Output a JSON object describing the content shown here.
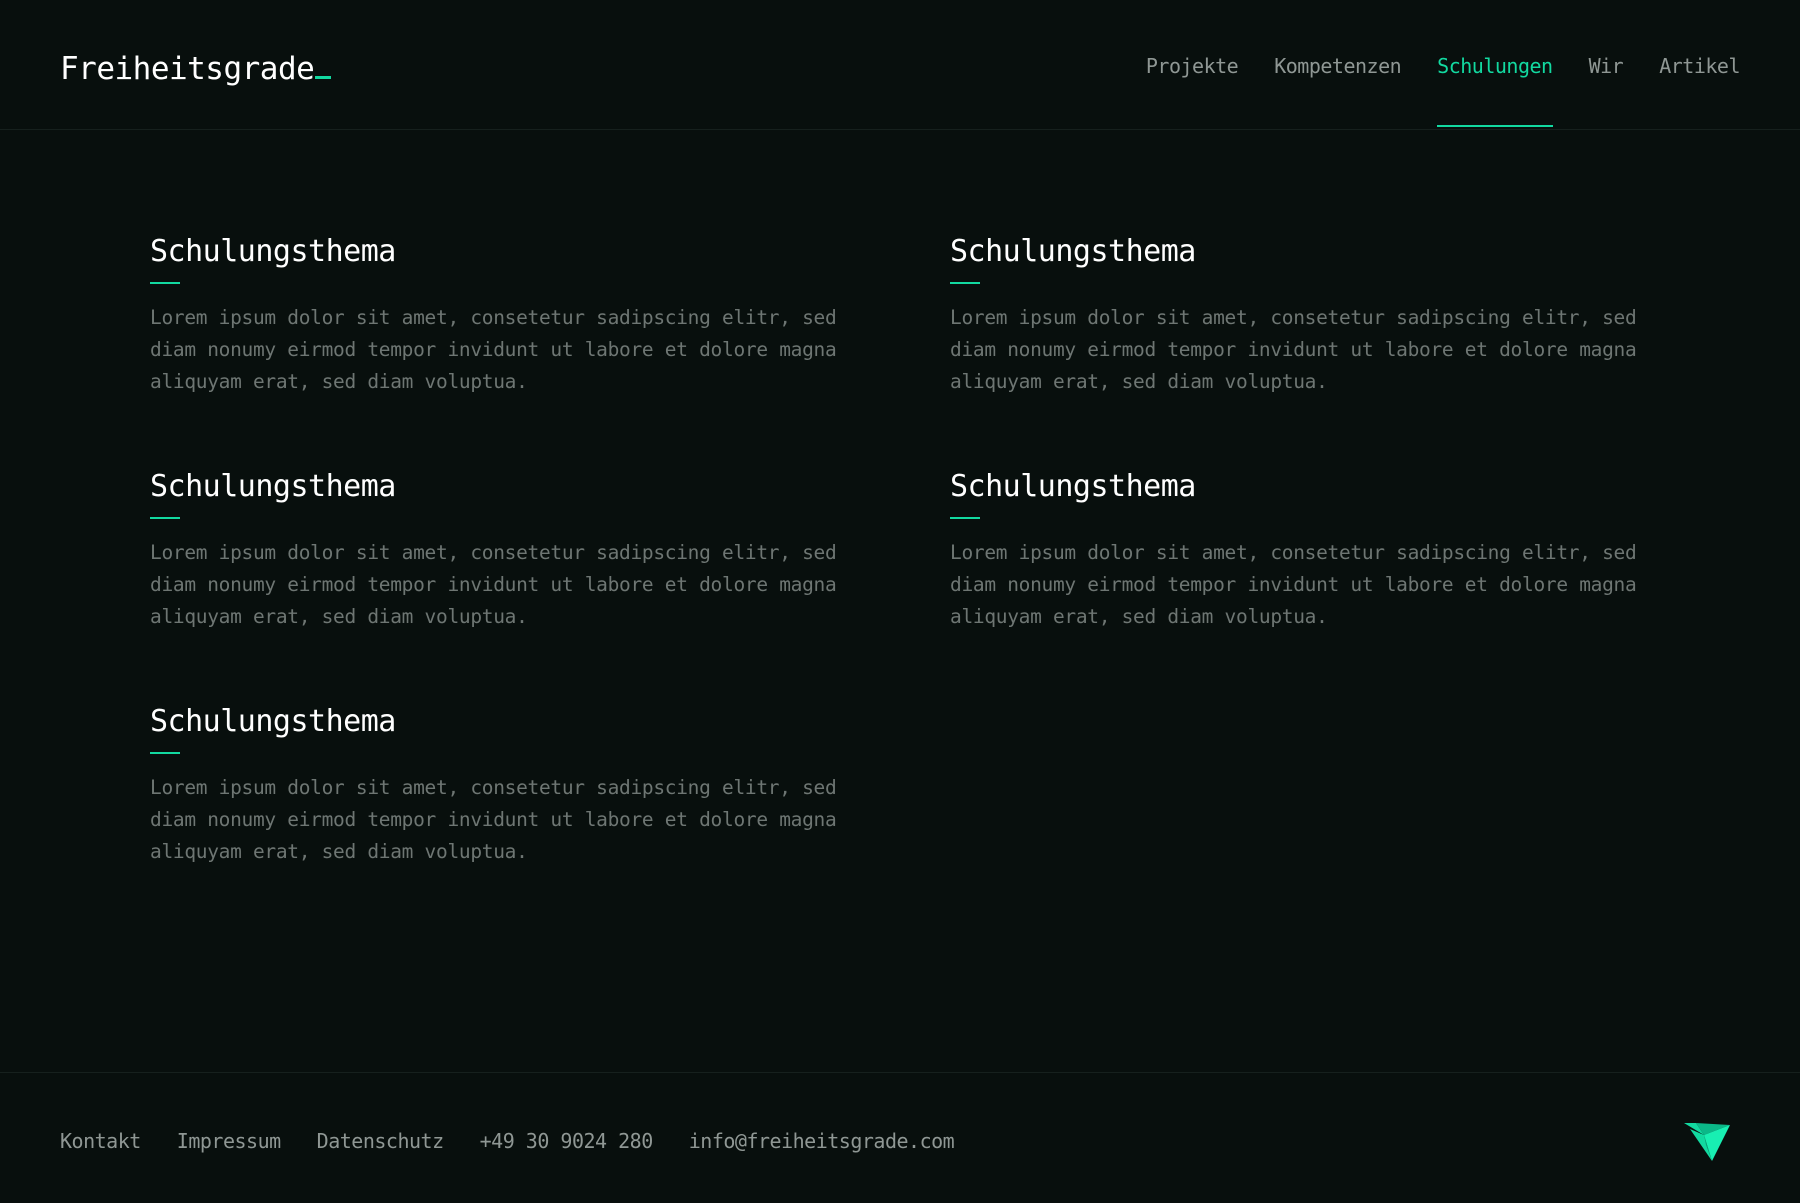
{
  "header": {
    "logo": "Freiheitsgrade",
    "nav": [
      {
        "label": "Projekte",
        "active": false
      },
      {
        "label": "Kompetenzen",
        "active": false
      },
      {
        "label": "Schulungen",
        "active": true
      },
      {
        "label": "Wir",
        "active": false
      },
      {
        "label": "Artikel",
        "active": false
      }
    ]
  },
  "topics": [
    {
      "title": "Schulungsthema",
      "text": "Lorem ipsum dolor sit amet, consetetur sadipscing elitr, sed diam nonumy eirmod tempor invidunt ut labore et dolore magna aliquyam erat, sed diam voluptua."
    },
    {
      "title": "Schulungsthema",
      "text": "Lorem ipsum dolor sit amet, consetetur sadipscing elitr, sed diam nonumy eirmod tempor invidunt ut labore et dolore magna aliquyam erat, sed diam voluptua."
    },
    {
      "title": "Schulungsthema",
      "text": "Lorem ipsum dolor sit amet, consetetur sadipscing elitr, sed diam nonumy eirmod tempor invidunt ut labore et dolore magna aliquyam erat, sed diam voluptua."
    },
    {
      "title": "Schulungsthema",
      "text": "Lorem ipsum dolor sit amet, consetetur sadipscing elitr, sed diam nonumy eirmod tempor invidunt ut labore et dolore magna aliquyam erat, sed diam voluptua."
    },
    {
      "title": "Schulungsthema",
      "text": "Lorem ipsum dolor sit amet, consetetur sadipscing elitr, sed diam nonumy eirmod tempor invidunt ut labore et dolore magna aliquyam erat, sed diam voluptua."
    }
  ],
  "footer": {
    "links": [
      "Kontakt",
      "Impressum",
      "Datenschutz",
      "+49 30 9024 280",
      "info@freiheitsgrade.com"
    ],
    "brand_icon": "origami-bird-icon"
  },
  "colors": {
    "background": "#080f0d",
    "accent": "#12d9a0",
    "text": "#ffffff",
    "muted": "#8f9794",
    "body_text": "#6e7673"
  }
}
